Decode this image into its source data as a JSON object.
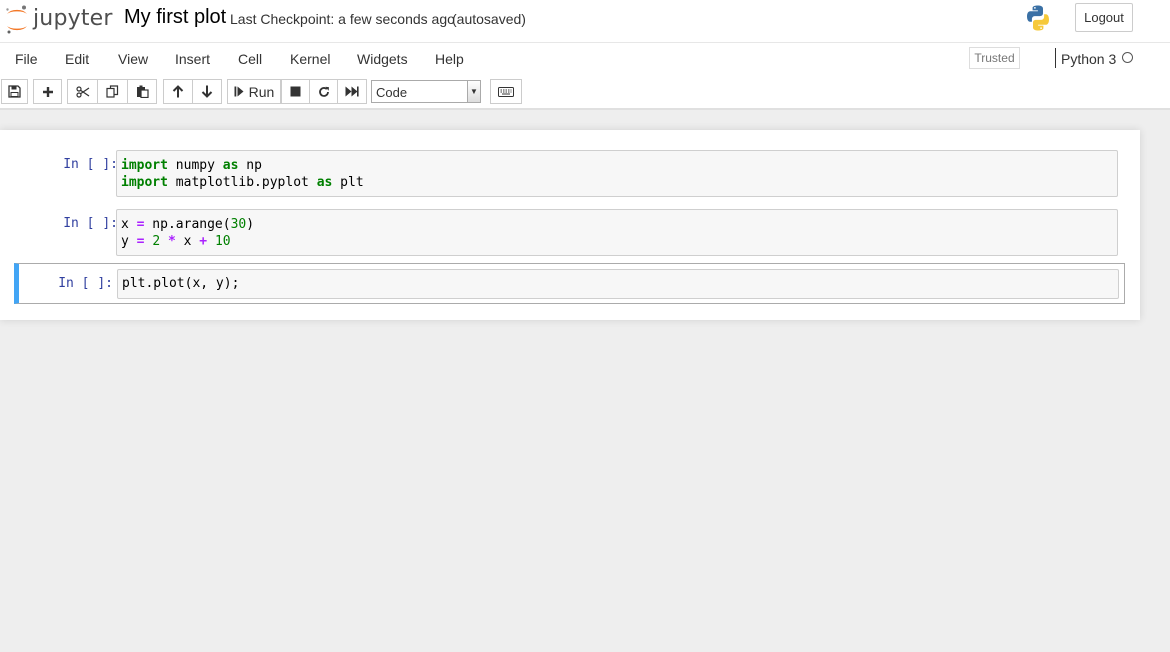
{
  "header": {
    "logo_text": "jupyter",
    "notebook_title": "My first plot",
    "checkpoint_text": "Last Checkpoint: a few seconds ago",
    "autosave_text": "(autosaved)",
    "logout_label": "Logout"
  },
  "menubar": {
    "items": [
      "File",
      "Edit",
      "View",
      "Insert",
      "Cell",
      "Kernel",
      "Widgets",
      "Help"
    ],
    "trusted_label": "Trusted",
    "kernel_name": "Python 3"
  },
  "toolbar": {
    "run_label": "Run",
    "cell_type": "Code",
    "icons": [
      "save-icon",
      "plus-icon",
      "scissors-icon",
      "copy-icon",
      "paste-icon",
      "arrow-up-icon",
      "arrow-down-icon",
      "step-forward-icon",
      "stop-icon",
      "refresh-icon",
      "fast-forward-icon",
      "keyboard-icon"
    ]
  },
  "cells": [
    {
      "prompt": "In [ ]:",
      "lines": [
        [
          {
            "t": "import",
            "c": "kw"
          },
          {
            "t": " numpy ",
            "c": ""
          },
          {
            "t": "as",
            "c": "kw"
          },
          {
            "t": " np",
            "c": ""
          }
        ],
        [
          {
            "t": "import",
            "c": "kw"
          },
          {
            "t": " matplotlib.pyplot ",
            "c": ""
          },
          {
            "t": "as",
            "c": "kw"
          },
          {
            "t": " plt",
            "c": ""
          }
        ]
      ]
    },
    {
      "prompt": "In [ ]:",
      "lines": [
        [
          {
            "t": "x ",
            "c": ""
          },
          {
            "t": "=",
            "c": "op"
          },
          {
            "t": " np.arange(",
            "c": ""
          },
          {
            "t": "30",
            "c": "num"
          },
          {
            "t": ")",
            "c": ""
          }
        ],
        [
          {
            "t": "y ",
            "c": ""
          },
          {
            "t": "=",
            "c": "op"
          },
          {
            "t": " ",
            "c": ""
          },
          {
            "t": "2",
            "c": "num"
          },
          {
            "t": " ",
            "c": ""
          },
          {
            "t": "*",
            "c": "op"
          },
          {
            "t": " x ",
            "c": ""
          },
          {
            "t": "+",
            "c": "op"
          },
          {
            "t": " ",
            "c": ""
          },
          {
            "t": "10",
            "c": "num"
          }
        ]
      ]
    },
    {
      "prompt": "In [ ]:",
      "lines": [
        [
          {
            "t": "plt.plot(x, y);",
            "c": ""
          }
        ]
      ]
    }
  ],
  "colors": {
    "selected_cell_accent": "#42a5f5",
    "prompt_color": "#303f9f",
    "keyword_color": "#008000",
    "operator_color": "#aa22ff"
  }
}
